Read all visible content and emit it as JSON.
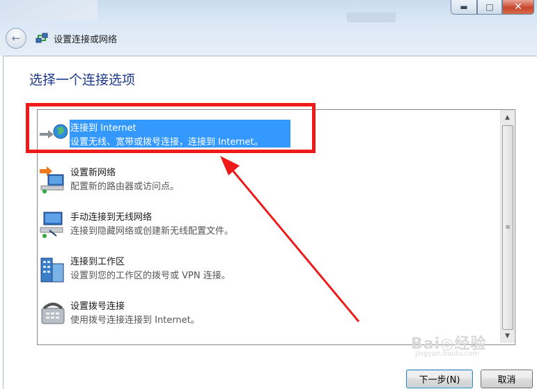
{
  "window": {
    "title": "设置连接或网络",
    "controls": {
      "minimize": "▬",
      "maximize": "□",
      "close": "✕"
    }
  },
  "page": {
    "heading": "选择一个连接选项"
  },
  "options": [
    {
      "title": "连接到 Internet",
      "desc": "设置无线、宽带或拨号连接，连接到 Internet。",
      "icon": "globe-icon",
      "selected": true
    },
    {
      "title": "设置新网络",
      "desc": "配置新的路由器或访问点。",
      "icon": "new-network-icon",
      "selected": false
    },
    {
      "title": "手动连接到无线网络",
      "desc": "连接到隐藏网络或创建新无线配置文件。",
      "icon": "wireless-network-icon",
      "selected": false
    },
    {
      "title": "连接到工作区",
      "desc": "设置到您的工作区的拨号或 VPN 连接。",
      "icon": "workplace-building-icon",
      "selected": false
    },
    {
      "title": "设置拨号连接",
      "desc": "使用拨号连接连接到 Internet。",
      "icon": "phone-modem-icon",
      "selected": false
    }
  ],
  "buttons": {
    "next": "下一步(N)",
    "cancel": "取消"
  },
  "annotations": {
    "highlight_color": "#ee1a1a"
  },
  "watermark": {
    "text": "Bai◎经验",
    "sub": "jingyan.baidu.com"
  },
  "colors": {
    "selection": "#3399ff",
    "heading": "#1e3a8c"
  }
}
